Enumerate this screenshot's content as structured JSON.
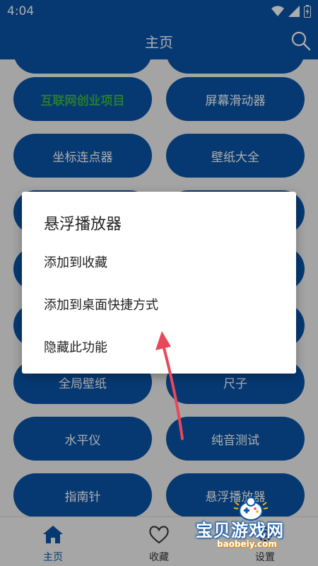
{
  "status_bar": {
    "time": "4:04"
  },
  "app_bar": {
    "title": "主页"
  },
  "tiles": [
    {
      "label": "互联网创业项目"
    },
    {
      "label": "屏幕滑动器"
    },
    {
      "label": "坐标连点器"
    },
    {
      "label": "壁纸大全"
    },
    {
      "label": "全局壁纸"
    },
    {
      "label": "尺子"
    },
    {
      "label": "水平仪"
    },
    {
      "label": "纯音测试"
    },
    {
      "label": "指南针"
    },
    {
      "label": "悬浮播放器"
    }
  ],
  "bottom_nav": [
    {
      "label": "主页",
      "icon": "home-icon"
    },
    {
      "label": "收藏",
      "icon": "heart-icon"
    },
    {
      "label": "设置",
      "icon": "gear-icon"
    }
  ],
  "dialog": {
    "title": "悬浮播放器",
    "items": [
      "添加到收藏",
      "添加到桌面快捷方式",
      "隐藏此功能"
    ]
  },
  "watermark": {
    "text": "宝贝游戏网",
    "url": "baobeiy.com"
  },
  "colors": {
    "primary": "#0a55a8",
    "accent_green": "#39b54a",
    "arrow": "#e8485a"
  }
}
